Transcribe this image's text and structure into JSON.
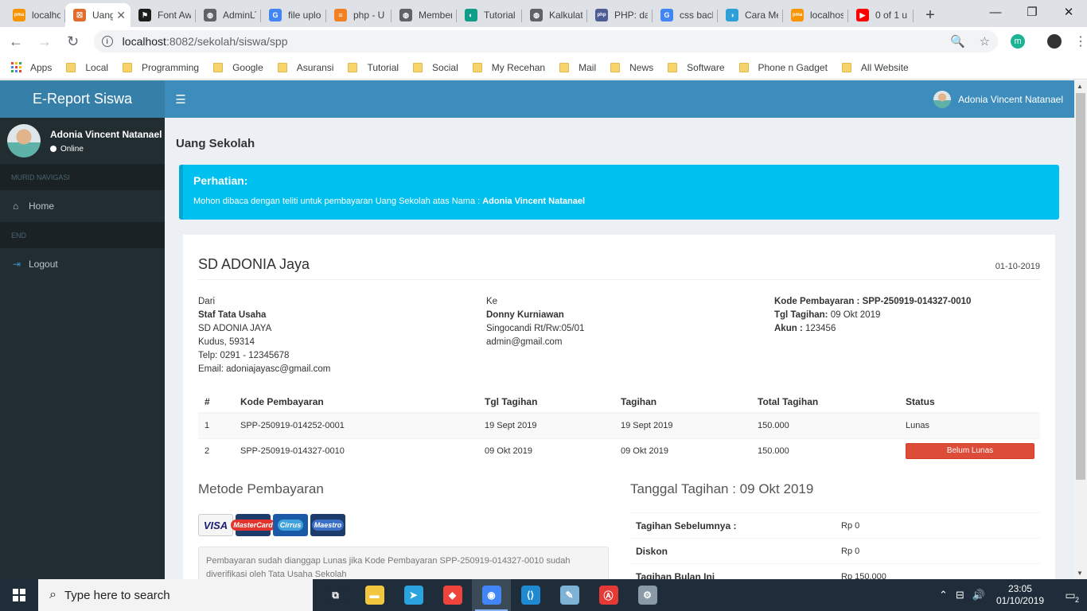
{
  "browser": {
    "tabs": [
      {
        "title": "localhost",
        "fav_color": "#f89406",
        "fav_glyph": "pma"
      },
      {
        "title": "Uang Sekolah",
        "fav_color": "#e06d2c",
        "fav_glyph": "☒",
        "active": true
      },
      {
        "title": "Font Awesome",
        "fav_color": "#1c1c1c",
        "fav_glyph": "⚑"
      },
      {
        "title": "AdminLTE",
        "fav_color": "#5f6368",
        "fav_glyph": "◍"
      },
      {
        "title": "file upload",
        "fav_color": "#4285f4",
        "fav_glyph": "G"
      },
      {
        "title": "php - U",
        "fav_color": "#f48024",
        "fav_glyph": "≡"
      },
      {
        "title": "Member",
        "fav_color": "#5f6368",
        "fav_glyph": "◍"
      },
      {
        "title": "Tutorial",
        "fav_color": "#0f9d8a",
        "fav_glyph": "◐"
      },
      {
        "title": "Kalkulator",
        "fav_color": "#5f6368",
        "fav_glyph": "◍"
      },
      {
        "title": "PHP: date",
        "fav_color": "#4f5b93",
        "fav_glyph": "php"
      },
      {
        "title": "css background",
        "fav_color": "#4285f4",
        "fav_glyph": "G"
      },
      {
        "title": "Cara Membuat",
        "fav_color": "#2f9fd8",
        "fav_glyph": "◑"
      },
      {
        "title": "localhost",
        "fav_color": "#f89406",
        "fav_glyph": "pma"
      },
      {
        "title": "0 of 1 u",
        "fav_color": "#ff0000",
        "fav_glyph": "▶"
      }
    ],
    "close_glyph": "✕",
    "newtab_glyph": "+",
    "window_controls": {
      "minimize": "—",
      "restore": "❐",
      "close": "✕"
    },
    "nav": {
      "back": "←",
      "forward": "→",
      "reload": "↻"
    },
    "url_host": "localhost",
    "url_rest": ":8082/sekolah/siswa/spp",
    "omnibox_icons": {
      "zoom": "🔍",
      "star": "☆"
    },
    "ext_letter": "m",
    "bookmarks": [
      "Apps",
      "Local",
      "Programming",
      "Google",
      "Asuransi",
      "Tutorial",
      "Social",
      "My Recehan",
      "Mail",
      "News",
      "Software",
      "Phone n Gadget",
      "All Website"
    ]
  },
  "app": {
    "brand": "E-Report Siswa",
    "user_name": "Adonia Vincent Natanael",
    "user_status": "Online",
    "nav_header": "MURID NAVIGASI",
    "end_header": "END",
    "menu": [
      {
        "label": "Home",
        "icon": "⌂"
      },
      {
        "label": "Logout",
        "icon": "⇥"
      }
    ],
    "hamburger": "☰",
    "page_title": "Uang Sekolah",
    "callout": {
      "title": "Perhatian:",
      "text": "Mohon dibaca dengan teliti untuk pembayaran Uang Sekolah atas Nama : ",
      "name": "Adonia Vincent Natanael"
    }
  },
  "invoice": {
    "school": "SD ADONIA Jaya",
    "date": "01-10-2019",
    "from": {
      "label": "Dari",
      "name": "Staf Tata Usaha",
      "lines": [
        "SD ADONIA JAYA",
        "Kudus, 59314",
        "Telp: 0291 - 12345678",
        "Email: adoniajayasc@gmail.com"
      ]
    },
    "to": {
      "label": "Ke",
      "name": "Donny Kurniawan",
      "lines": [
        "Singocandi Rt/Rw:05/01",
        "admin@gmail.com"
      ]
    },
    "meta": {
      "kode_label": "Kode Pembayaran : SPP-250919-014327-0010",
      "tgl_label": "Tgl Tagihan:",
      "tgl_value": " 09 Okt 2019",
      "akun_label": "Akun :",
      "akun_value": " 123456"
    },
    "columns": [
      "#",
      "Kode Pembayaran",
      "Tgl Tagihan",
      "Tagihan",
      "Total Tagihan",
      "Status"
    ],
    "rows": [
      {
        "no": "1",
        "kode": "SPP-250919-014252-0001",
        "tgl": "19 Sept 2019",
        "tagihan": "19 Sept 2019",
        "total": "150.000",
        "status": "Lunas",
        "status_badge": false
      },
      {
        "no": "2",
        "kode": "SPP-250919-014327-0010",
        "tgl": "09 Okt 2019",
        "tagihan": "09 Okt 2019",
        "total": "150.000",
        "status": "Belum Lunas",
        "status_badge": true
      }
    ],
    "payment_title": "Metode Pembayaran",
    "cards": [
      "VISA",
      "MasterCard",
      "Cirrus",
      "Maestro"
    ],
    "note": "Pembayaran sudah dianggap Lunas jika Kode Pembayaran SPP-250919-014327-0010 sudah diverifikasi oleh Tata Usaha Sekolah",
    "due_title": "Tanggal Tagihan : 09 Okt 2019",
    "summary": [
      {
        "label": "Tagihan Sebelumnya :",
        "value": "Rp 0"
      },
      {
        "label": "Diskon",
        "value": "Rp 0"
      },
      {
        "label": "Tagihan Bulan Ini",
        "value": "Rp 150.000"
      }
    ]
  },
  "taskbar": {
    "search_placeholder": "Type here to search",
    "time": "23:05",
    "date": "01/10/2019",
    "notif_count": "2",
    "apps": [
      {
        "name": "task-view",
        "color": "#1f2d3a",
        "glyph": "⧉"
      },
      {
        "name": "file-explorer",
        "color": "#f3c640",
        "glyph": "▬"
      },
      {
        "name": "telegram",
        "color": "#2aa3df",
        "glyph": "➤"
      },
      {
        "name": "anydesk",
        "color": "#ef443b",
        "glyph": "◆"
      },
      {
        "name": "chrome",
        "color": "#4285f4",
        "glyph": "◉",
        "active": true
      },
      {
        "name": "vscode",
        "color": "#1f8ad2",
        "glyph": "⟨⟩"
      },
      {
        "name": "notepad",
        "color": "#7fb3d5",
        "glyph": "✎"
      },
      {
        "name": "acrobat",
        "color": "#e53935",
        "glyph": "Ⓐ"
      },
      {
        "name": "xampp",
        "color": "#8a9aa6",
        "glyph": "⚙"
      }
    ],
    "tray_icons": [
      "⌃",
      "⊟",
      "🔊"
    ]
  }
}
